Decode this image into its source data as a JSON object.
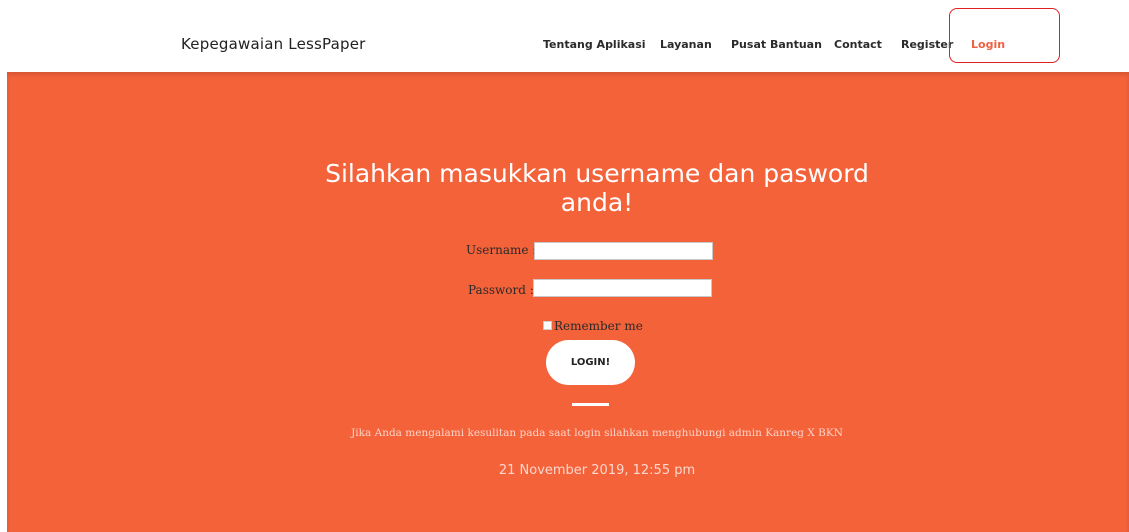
{
  "navbar": {
    "brand": "Kepegawaian LessPaper",
    "items": [
      {
        "label": "Tentang Aplikasi"
      },
      {
        "label": "Layanan"
      },
      {
        "label": "Pusat Bantuan"
      },
      {
        "label": "Contact"
      },
      {
        "label": "Register"
      },
      {
        "label": "Login",
        "active": true
      }
    ],
    "active_color": "#f05f40"
  },
  "hero": {
    "background_color": "#f4623a",
    "heading_line1": "Silahkan masukkan username dan pasword",
    "heading_line2": "anda!",
    "form": {
      "username_label": "Username :",
      "username_value": "",
      "password_label": "Password :",
      "password_value": "",
      "remember_label": "Remember me",
      "remember_checked": false,
      "submit_label": "LOGIN!"
    },
    "help_text": "Jika Anda mengalami kesulitan pada saat login silahkan menghubungi admin Kanreg X BKN",
    "datetime": "21 November 2019, 12:55 pm"
  }
}
